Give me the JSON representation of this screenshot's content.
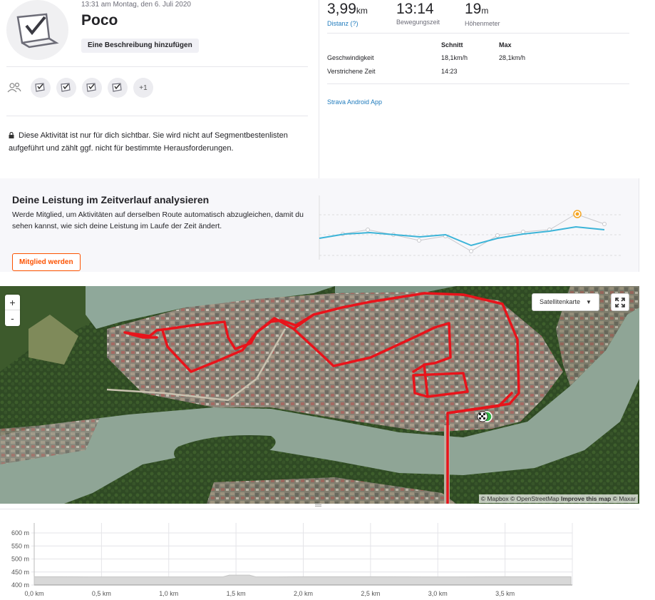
{
  "activity": {
    "datetime": "13:31 am Montag, den 6. Juli 2020",
    "name": "Poco",
    "add_description": "Eine Beschreibung hinzufügen",
    "kudos_more": "+1",
    "privacy_text": "Diese Aktivität ist nur für dich sichtbar. Sie wird nicht auf Segmentbestenlisten aufgeführt und zählt ggf. nicht für bestimmte Herausforderungen."
  },
  "stats": {
    "distance": {
      "value": "3,99",
      "unit": "km",
      "label": "Distanz (?)"
    },
    "moving_time": {
      "value": "13:14",
      "label": "Bewegungszeit"
    },
    "elevation": {
      "value": "19",
      "unit": "m",
      "label": "Höhenmeter"
    },
    "table": {
      "col_avg": "Schnitt",
      "col_max": "Max",
      "rows": [
        {
          "label": "Geschwindigkeit",
          "avg": "18,1km/h",
          "max": "28,1km/h"
        },
        {
          "label": "Verstrichene Zeit",
          "avg": "14:23",
          "max": ""
        }
      ]
    },
    "app_link": "Strava Android App"
  },
  "promo": {
    "title": "Deine Leistung im Zeitverlauf analysieren",
    "text": "Werde Mitglied, um Aktivitäten auf derselben Route automatisch abzugleichen, damit du sehen kannst, wie sich deine Leistung im Laufe der Zeit ändert.",
    "button": "Mitglied werden"
  },
  "map": {
    "zoom_in": "+",
    "zoom_out": "-",
    "layer": "Satellitenkarte",
    "attribution_a": "© Mapbox © OpenStreetMap ",
    "attribution_b": "Improve this map",
    "attribution_c": " © Maxar",
    "route_color": "#e8141b"
  },
  "chart_data": {
    "type": "area",
    "y_ticks": [
      "600 m",
      "550 m",
      "500 m",
      "450 m",
      "400 m"
    ],
    "ylim": [
      400,
      600
    ],
    "x_ticks": [
      "0,0 km",
      "0,5 km",
      "1,0 km",
      "1,5 km",
      "2,0 km",
      "2,5 km",
      "3,0 km",
      "3,5 km"
    ],
    "xlim": [
      0,
      4.0
    ],
    "x": [
      0,
      0.2,
      0.5,
      1.0,
      1.4,
      1.45,
      1.6,
      1.65,
      1.8,
      2.0,
      2.5,
      3.0,
      3.5,
      3.99
    ],
    "elevation": [
      432,
      432,
      431,
      431,
      431,
      438,
      438,
      431,
      431,
      432,
      432,
      431,
      432,
      432
    ],
    "fill_color": "#d8d8d8"
  }
}
